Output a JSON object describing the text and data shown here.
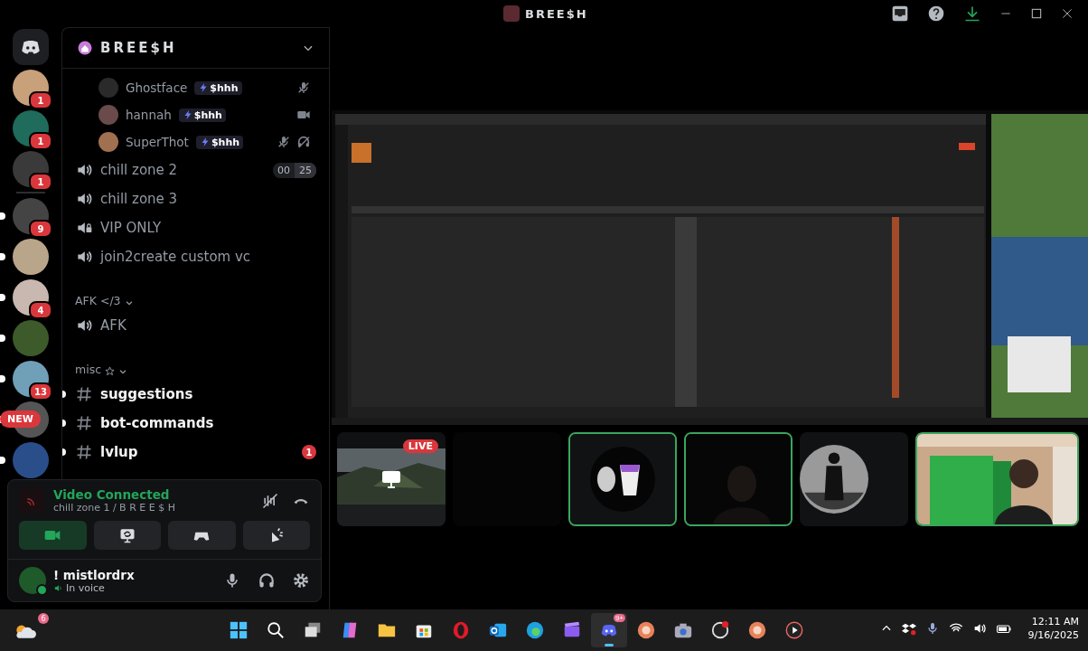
{
  "title_bar": {
    "server_name": "BREE$H"
  },
  "servers": [
    {
      "kind": "home",
      "unread": false
    },
    {
      "kind": "server",
      "badge": "1",
      "unread": false
    },
    {
      "kind": "server",
      "badge": "1",
      "unread": false
    },
    {
      "kind": "server",
      "badge": "1",
      "unread": false
    },
    {
      "kind": "divider"
    },
    {
      "kind": "server",
      "badge": "9",
      "unread": true
    },
    {
      "kind": "server",
      "unread": true
    },
    {
      "kind": "server",
      "badge": "4",
      "unread": true
    },
    {
      "kind": "server",
      "unread": true
    },
    {
      "kind": "server",
      "badge": "13",
      "unread": true
    },
    {
      "kind": "server",
      "pill": "NEW",
      "unread": true
    },
    {
      "kind": "server",
      "unread": true
    }
  ],
  "channel_panel": {
    "title": "BREE$H",
    "items": [
      {
        "kind": "member",
        "name": "Ghostface",
        "tag": "$hhh",
        "muted": true,
        "deafened": false,
        "video": false
      },
      {
        "kind": "member",
        "name": "hannah",
        "tag": "$hhh",
        "muted": false,
        "deafened": false,
        "video": true
      },
      {
        "kind": "member",
        "name": "SuperThot",
        "tag": "$hhh",
        "muted": true,
        "deafened": true,
        "video": false
      },
      {
        "kind": "voice",
        "name": "chill zone 2",
        "locked": false,
        "users": "00",
        "limit": "25"
      },
      {
        "kind": "voice",
        "name": "chill zone 3",
        "locked": false
      },
      {
        "kind": "voice",
        "name": "VIP ONLY",
        "locked": true
      },
      {
        "kind": "voice",
        "name": "join2create custom vc",
        "locked": false
      },
      {
        "kind": "category",
        "name": "AFK </3"
      },
      {
        "kind": "voice",
        "name": "AFK",
        "locked": false
      },
      {
        "kind": "category",
        "name": "misc"
      },
      {
        "kind": "text",
        "name": "suggestions",
        "unread": true
      },
      {
        "kind": "text",
        "name": "bot-commands",
        "unread": true
      },
      {
        "kind": "text",
        "name": "lvlup",
        "unread": true,
        "badge": "1"
      }
    ]
  },
  "voice_panel": {
    "status": "Video Connected",
    "location": "chill zone 1 / B R E E $ H",
    "buttons": [
      {
        "kind": "camera",
        "on": true
      },
      {
        "kind": "screen",
        "on": false
      },
      {
        "kind": "activity",
        "on": false
      },
      {
        "kind": "soundboard",
        "on": false
      }
    ]
  },
  "user": {
    "name": "! mistlordrx",
    "status": "In voice"
  },
  "tiles": [
    {
      "kind": "stream",
      "live": "LIVE",
      "speaking": false
    },
    {
      "kind": "empty",
      "speaking": false
    },
    {
      "kind": "avatar",
      "speaking": true
    },
    {
      "kind": "video",
      "speaking": true
    },
    {
      "kind": "avatar",
      "speaking": false
    },
    {
      "kind": "video",
      "speaking": true
    }
  ],
  "taskbar": {
    "weather_badge": "6",
    "apps": [
      {
        "kind": "start",
        "selected": false
      },
      {
        "kind": "search",
        "selected": false
      },
      {
        "kind": "taskview",
        "selected": false
      },
      {
        "kind": "copilot",
        "selected": false
      },
      {
        "kind": "files",
        "selected": false
      },
      {
        "kind": "store",
        "selected": false
      },
      {
        "kind": "opera",
        "selected": false
      },
      {
        "kind": "outlook",
        "selected": false
      },
      {
        "kind": "edge",
        "selected": false
      },
      {
        "kind": "clipchamp",
        "selected": false
      },
      {
        "kind": "discord",
        "selected": true,
        "badge": "9+"
      },
      {
        "kind": "app",
        "selected": false
      },
      {
        "kind": "camera",
        "selected": false
      },
      {
        "kind": "obs",
        "selected": false
      },
      {
        "kind": "app",
        "selected": false
      },
      {
        "kind": "player",
        "selected": false
      }
    ],
    "time": "12:11 AM",
    "date": "9/16/2025"
  }
}
